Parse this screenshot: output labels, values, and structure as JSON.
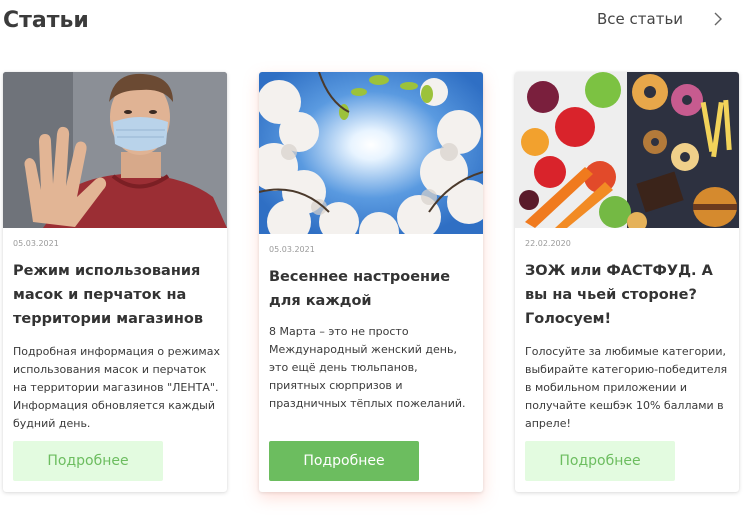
{
  "header": {
    "title": "Статьи",
    "all_link": "Все статьи"
  },
  "articles": [
    {
      "date": "05.03.2021",
      "title": "Режим использования масок и перчаток на территории магазинов",
      "description": "Подробная информация о режимах использования масок и перчаток на территории магазинов \"ЛЕНТА\". Информация обновляется каждый будний день.",
      "button": "Подробнее"
    },
    {
      "date": "05.03.2021",
      "title": "Весеннее настроение для каждой",
      "description": "8 Марта – это не просто Международный женский день, это ещё день тюльпанов, приятных сюрпризов и праздничных тёплых пожеланий.",
      "button": "Подробнее"
    },
    {
      "date": "22.02.2020",
      "title": "ЗОЖ или ФАСТФУД. А вы на чьей стороне? Голосуем!",
      "description": "Голосуйте за любимые категории, выбирайте категорию-победителя в мобильном приложении и получайте кешбэк 10% баллами в апреле!",
      "button": "Подробнее"
    }
  ],
  "colors": {
    "accent_green": "#6cbd5f",
    "light_green": "#e3fbe0"
  }
}
